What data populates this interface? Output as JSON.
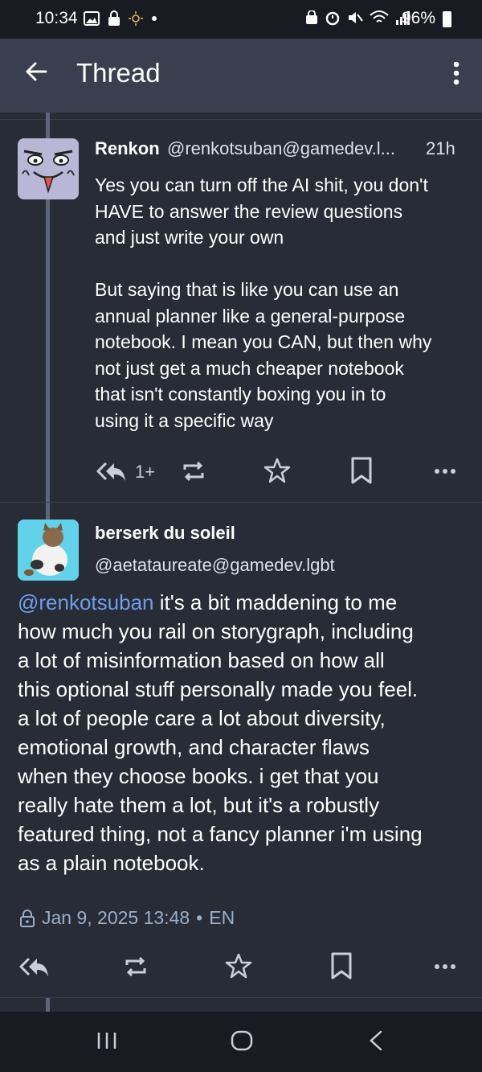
{
  "status_bar": {
    "time": "10:34",
    "battery": "96%",
    "icons_left": [
      "image-icon",
      "lock-icon",
      "sun-icon",
      "dot-icon"
    ],
    "icons_right": [
      "vpn-icon",
      "alarm-icon",
      "mute-icon",
      "wifi-icon",
      "signal-icon",
      "battery-icon"
    ]
  },
  "header": {
    "title": "Thread"
  },
  "posts": [
    {
      "name": "Renkon",
      "handle": "@renkotsuban@gamedev.l...",
      "time": "21h",
      "paragraphs": [
        [
          "Yes you can turn off the AI shit, you don't",
          "HAVE to answer the review questions",
          "and just write your own"
        ],
        [
          "But saying that is like you can use an",
          "annual planner like a general-purpose",
          "notebook. I mean you CAN, but then why",
          "not just get a much cheaper notebook",
          "that isn't constantly boxing you in to",
          "using it a specific way"
        ]
      ],
      "reply_count": "1+"
    },
    {
      "name": "berserk du soleil",
      "handle": "@aetataureate@gamedev.lgbt",
      "mention": "@renkotsuban",
      "lines": [
        " it's a bit maddening to me",
        "how much you rail on storygraph, including",
        "a lot of misinformation based on how all",
        "this optional stuff personally made you feel.",
        "a lot of people care a lot about diversity,",
        "emotional growth, and character flaws",
        "when they choose books. i get that you",
        "really hate them a lot, but it's a robustly",
        "featured thing, not a fancy planner i'm using",
        "as a plain notebook."
      ],
      "date": "Jan 9, 2025 13:48",
      "lang": "EN"
    }
  ],
  "colors": {
    "background": "#282c37",
    "appbar": "#393f4f",
    "mention": "#6f9ee8",
    "text_secondary": "#d9e1e8"
  }
}
